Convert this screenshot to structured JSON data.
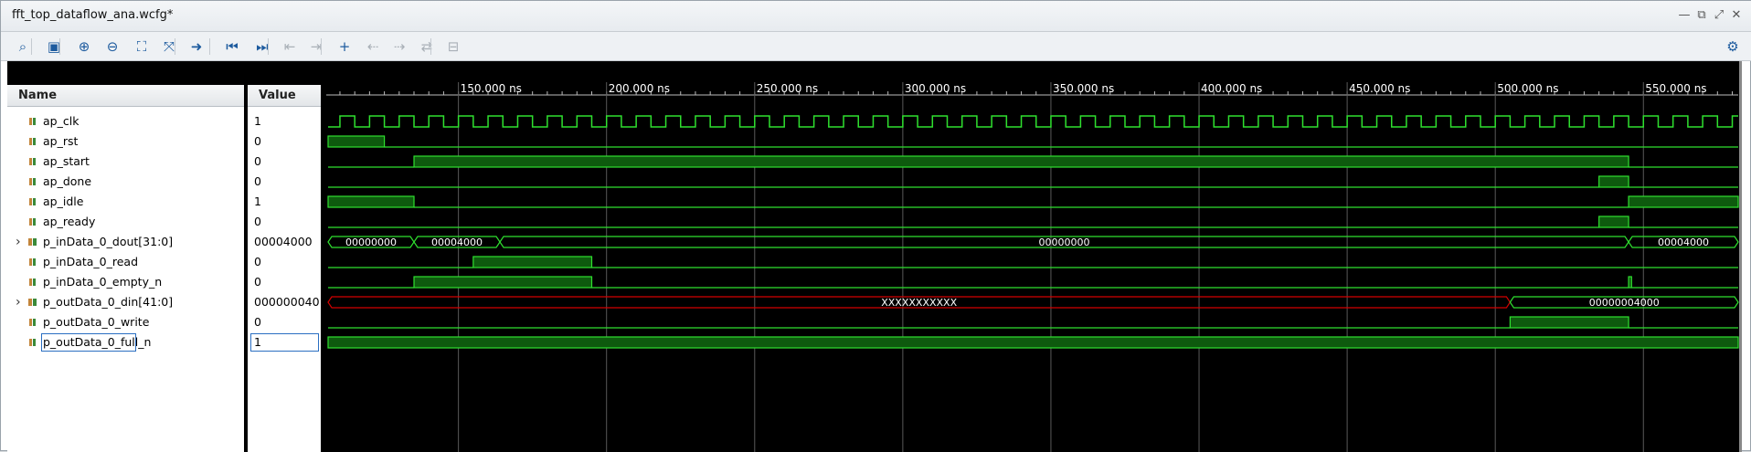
{
  "window": {
    "title": "fft_top_dataflow_ana.wcfg*"
  },
  "window_controls": [
    "minimize-icon",
    "restore-icon",
    "maximize-icon",
    "close-icon"
  ],
  "toolbar": [
    {
      "name": "search-icon",
      "glyph": "⌕"
    },
    {
      "name": "save-icon",
      "glyph": "▣"
    },
    {
      "name": "zoom-in-icon",
      "glyph": "⊕"
    },
    {
      "name": "zoom-out-icon",
      "glyph": "⊖"
    },
    {
      "name": "zoom-fit-icon",
      "glyph": "⛶"
    },
    {
      "name": "zoom-to-cursor-icon",
      "glyph": "⤧"
    },
    {
      "name": "goto-cursor-icon",
      "glyph": "➜"
    },
    {
      "name": "go-to-time-0-icon",
      "glyph": "⏮"
    },
    {
      "name": "go-to-last-time-icon",
      "glyph": "⏭"
    },
    {
      "name": "previous-transition-icon",
      "glyph": "⇤"
    },
    {
      "name": "next-transition-icon",
      "glyph": "⇥"
    },
    {
      "name": "add-marker-icon",
      "glyph": "+"
    },
    {
      "name": "previous-marker-icon",
      "glyph": "⇠"
    },
    {
      "name": "next-marker-icon",
      "glyph": "⇢"
    },
    {
      "name": "swap-cursors-icon",
      "glyph": "⇄"
    },
    {
      "name": "snap-to-transition-icon",
      "glyph": "⊟"
    }
  ],
  "settings_icon": "gear-icon",
  "columns": {
    "name": "Name",
    "value": "Value"
  },
  "signals": [
    {
      "name": "ap_clk",
      "value": "1",
      "bus": false
    },
    {
      "name": "ap_rst",
      "value": "0",
      "bus": false
    },
    {
      "name": "ap_start",
      "value": "0",
      "bus": false
    },
    {
      "name": "ap_done",
      "value": "0",
      "bus": false
    },
    {
      "name": "ap_idle",
      "value": "1",
      "bus": false
    },
    {
      "name": "ap_ready",
      "value": "0",
      "bus": false
    },
    {
      "name": "p_inData_0_dout[31:0]",
      "value": "00004000",
      "bus": true
    },
    {
      "name": "p_inData_0_read",
      "value": "0",
      "bus": false
    },
    {
      "name": "p_inData_0_empty_n",
      "value": "0",
      "bus": false
    },
    {
      "name": "p_outData_0_din[41:0]",
      "value": "000000040",
      "bus": true
    },
    {
      "name": "p_outData_0_write",
      "value": "0",
      "bus": false
    },
    {
      "name": "p_outData_0_full_n",
      "value": "1",
      "bus": false
    }
  ],
  "time_axis": {
    "unit": "ns",
    "labels": [
      "150.000 ns",
      "200.000 ns",
      "250.000 ns",
      "300.000 ns",
      "350.000 ns",
      "400.000 ns",
      "450.000 ns",
      "500.000 ns",
      "550.000 ns"
    ],
    "label_times": [
      150,
      200,
      250,
      300,
      350,
      400,
      450,
      500,
      550
    ],
    "view_start": 106,
    "view_end": 582,
    "clock_period": 10
  },
  "waveforms": {
    "ap_rst": [
      [
        106,
        1
      ],
      [
        125,
        0
      ]
    ],
    "ap_start": [
      [
        106,
        0
      ],
      [
        135,
        1
      ],
      [
        545,
        0
      ]
    ],
    "ap_done": [
      [
        106,
        0
      ],
      [
        535,
        1
      ],
      [
        545,
        0
      ]
    ],
    "ap_idle": [
      [
        106,
        1
      ],
      [
        135,
        0
      ],
      [
        545,
        1
      ]
    ],
    "ap_ready": [
      [
        106,
        0
      ],
      [
        535,
        1
      ],
      [
        545,
        0
      ]
    ],
    "p_inData_0_read": [
      [
        106,
        0
      ],
      [
        155,
        1
      ],
      [
        195,
        0
      ]
    ],
    "p_inData_0_empty_n": [
      [
        106,
        0
      ],
      [
        135,
        1
      ],
      [
        195,
        0
      ],
      [
        545,
        1
      ],
      [
        546,
        0
      ]
    ],
    "p_outData_0_write": [
      [
        106,
        0
      ],
      [
        505,
        1
      ],
      [
        545,
        0
      ]
    ],
    "p_outData_0_full_n": [
      [
        106,
        1
      ]
    ]
  },
  "bus_segments": {
    "p_inData_0_dout[31:0]": [
      {
        "from": 106,
        "to": 135,
        "label": "00000000"
      },
      {
        "from": 135,
        "to": 164,
        "label": "00004000"
      },
      {
        "from": 164,
        "to": 545,
        "label": "00000000"
      },
      {
        "from": 545,
        "to": 582,
        "label": "00004000"
      }
    ],
    "p_outData_0_din[41:0]": [
      {
        "from": 106,
        "to": 505,
        "label": "XXXXXXXXXXX",
        "undefined": true
      },
      {
        "from": 505,
        "to": 582,
        "label": "00000004000"
      }
    ]
  },
  "colors": {
    "wave_green": "#2fe02f",
    "wave_fill": "#0e5a0e",
    "undefined_red": "#d40000",
    "grid": "#5a5a5a",
    "selection": "#2b6fc2",
    "toolbar_icon": "#1d5b9e"
  }
}
